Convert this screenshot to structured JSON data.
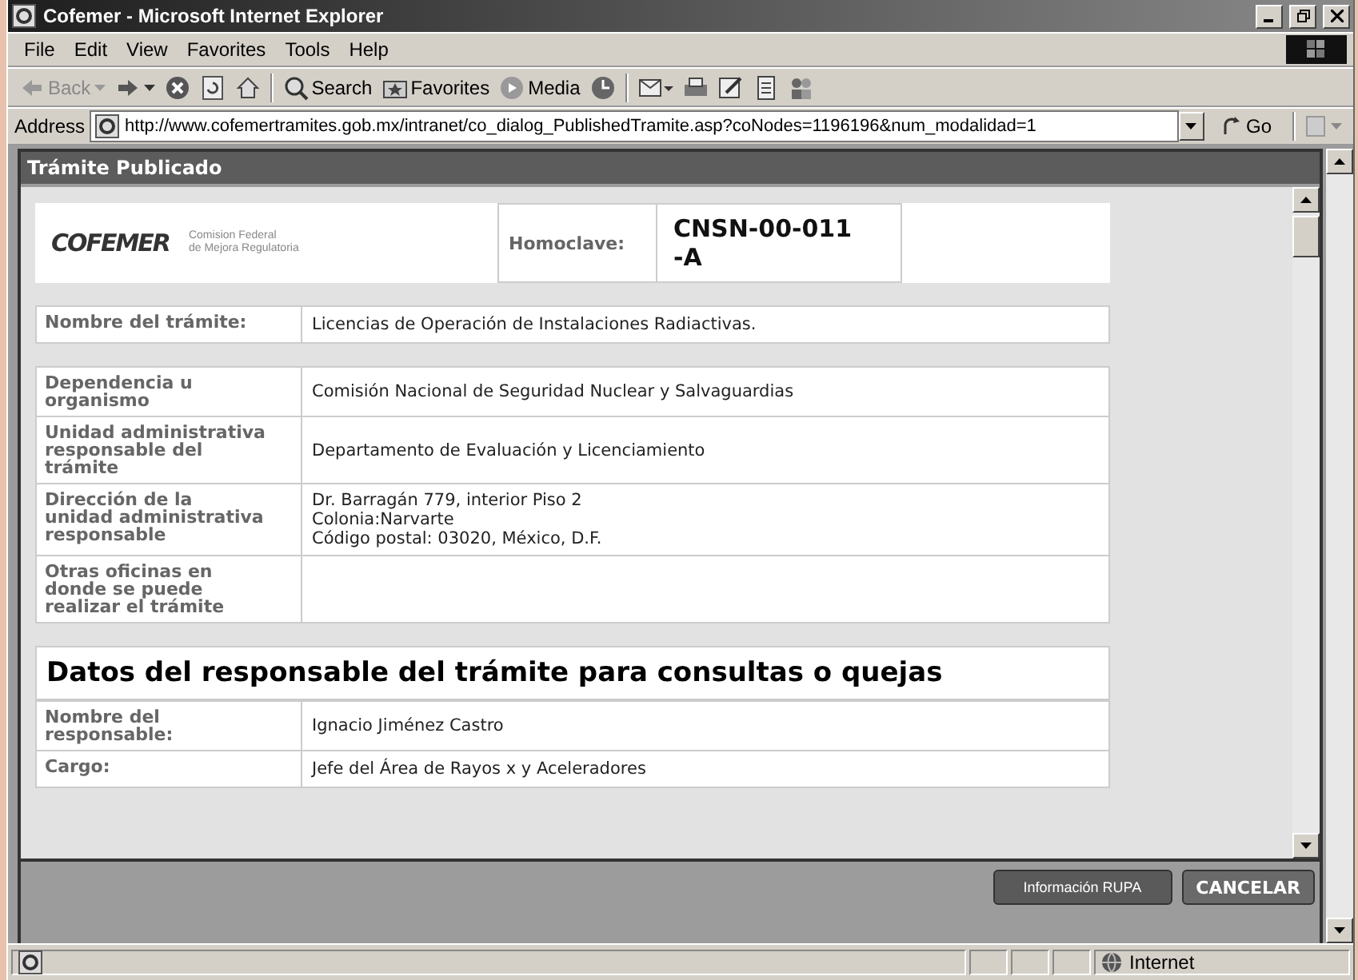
{
  "window": {
    "title": "Cofemer - Microsoft Internet Explorer"
  },
  "menu": [
    {
      "label": "File"
    },
    {
      "label": "Edit"
    },
    {
      "label": "View"
    },
    {
      "label": "Favorites"
    },
    {
      "label": "Tools"
    },
    {
      "label": "Help"
    }
  ],
  "toolbar": [
    {
      "kind": "back",
      "label": "Back",
      "disabled": true
    },
    {
      "kind": "forward",
      "disabled": false
    },
    {
      "kind": "stop"
    },
    {
      "kind": "refresh"
    },
    {
      "kind": "home"
    },
    {
      "kind": "sep"
    },
    {
      "kind": "search",
      "label": "Search"
    },
    {
      "kind": "favorites",
      "label": "Favorites"
    },
    {
      "kind": "media",
      "label": "Media"
    },
    {
      "kind": "history"
    },
    {
      "kind": "sep"
    },
    {
      "kind": "mail"
    },
    {
      "kind": "print"
    },
    {
      "kind": "edit"
    },
    {
      "kind": "discuss"
    },
    {
      "kind": "messenger"
    }
  ],
  "address": {
    "label": "Address",
    "value": "http://www.cofemertramites.gob.mx/intranet/co_dialog_PublishedTramite.asp?coNodes=1196196&num_modalidad=1",
    "go": "Go"
  },
  "dialog": {
    "title": "Trámite Publicado",
    "logo": {
      "mark": "COFEMER",
      "line1": "Comision Federal",
      "line2": "de Mejora Regulatoria"
    },
    "homoclave": {
      "label": "Homoclave:",
      "value": "CNSN-00-011 -A"
    },
    "sections": [
      [
        {
          "label": "Nombre del trámite:",
          "value": "Licencias de Operación de Instalaciones Radiactivas."
        }
      ],
      [
        {
          "label": "Dependencia u organismo",
          "value": "Comisión Nacional de Seguridad Nuclear y Salvaguardias"
        },
        {
          "label": "Unidad administrativa responsable del trámite",
          "value": "Departamento de Evaluación y Licenciamiento"
        },
        {
          "label": "Dirección de la unidad administrativa responsable",
          "value": "Dr. Barragán 779, interior Piso 2\nColonia:Narvarte\nCódigo postal: 03020, México, D.F."
        },
        {
          "label": "Otras oficinas en donde se puede realizar el trámite"
        }
      ]
    ],
    "responsible": {
      "heading": "Datos del responsable del trámite para consultas o quejas",
      "rows": [
        {
          "label": "Nombre del responsable:",
          "value": "Ignacio Jiménez Castro"
        },
        {
          "label": "Cargo:",
          "value": "Jefe del Área de Rayos x y Aceleradores"
        }
      ]
    },
    "buttons": [
      {
        "kind": "secondary",
        "label": "Información RUPA"
      },
      {
        "kind": "primary",
        "label": "CANCELAR"
      }
    ]
  },
  "status_bar": {
    "zone": "Internet"
  }
}
